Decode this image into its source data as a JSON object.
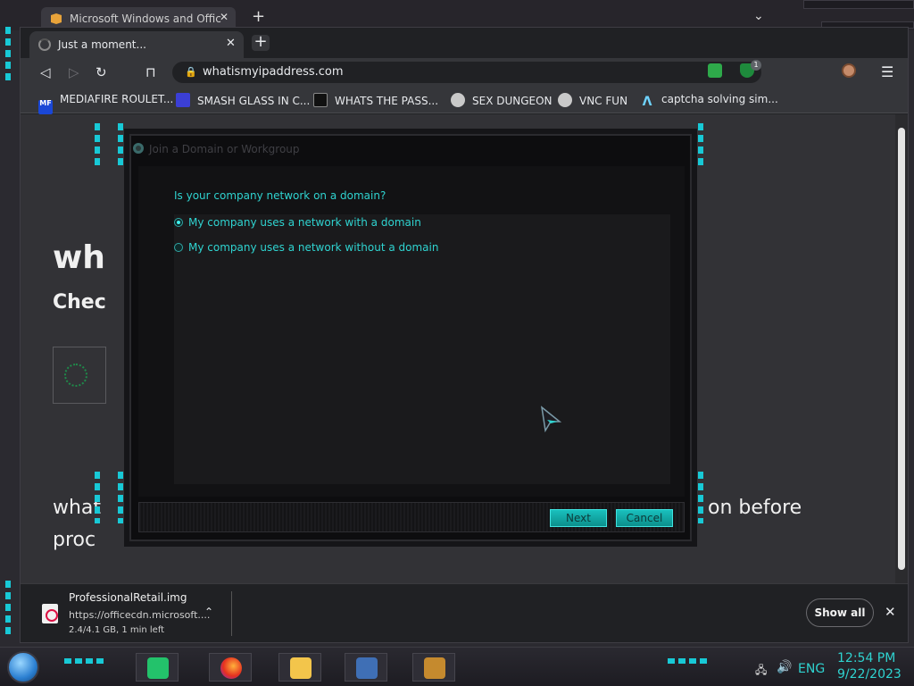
{
  "back_window": {
    "tab_title": "Microsoft Windows and Offic",
    "tab_close": "✕",
    "new_tab": "+",
    "minimize": "⌄"
  },
  "browser": {
    "tab": {
      "title": "Just a moment...",
      "close": "✕"
    },
    "new_tab": "+",
    "toolbar": {
      "back": "◁",
      "forward": "▷",
      "reload": "↻",
      "bookmark": "⊓",
      "url": "whatismyipaddress.com",
      "lock": "🔒",
      "ext_badge": "1",
      "menu": "☰"
    },
    "bookmarks": [
      {
        "label": "MEDIAFIRE ROULET...",
        "icon": "MF"
      },
      {
        "label": "SMASH GLASS IN C...",
        "icon": ""
      },
      {
        "label": "WHATS THE PASS...",
        "icon": ""
      },
      {
        "label": "SEX DUNGEON",
        "icon": ""
      },
      {
        "label": "VNC FUN",
        "icon": ""
      },
      {
        "label": "captcha solving sim...",
        "icon": "Λ"
      }
    ],
    "page": {
      "heading": "wh",
      "subheading": "Chec",
      "para_line1": "what",
      "para_line2": "proc",
      "para_right": "on before"
    },
    "download": {
      "file_name": "ProfessionalRetail.img",
      "url": "https://officecdn.microsoft....",
      "status": "2.4/4.1 GB, 1 min left",
      "chevron": "⌃",
      "show_all": "Show all",
      "close": "✕"
    }
  },
  "dialog": {
    "title": "Join a Domain or Workgroup",
    "question": "Is your company network on a domain?",
    "options": [
      {
        "label": "My company uses a network with a domain",
        "selected": true
      },
      {
        "label": "My company uses a network without a domain",
        "selected": false
      }
    ],
    "next": "Next",
    "cancel": "Cancel"
  },
  "taskbar": {
    "language": "ENG",
    "time": "12:54 PM",
    "date": "9/22/2023",
    "network_icon": "🖧",
    "volume_icon": "🔊"
  },
  "colors": {
    "accent_cyan": "#2fd3d0",
    "button_cyan": "#19c0bd",
    "page_bg": "#323236"
  }
}
